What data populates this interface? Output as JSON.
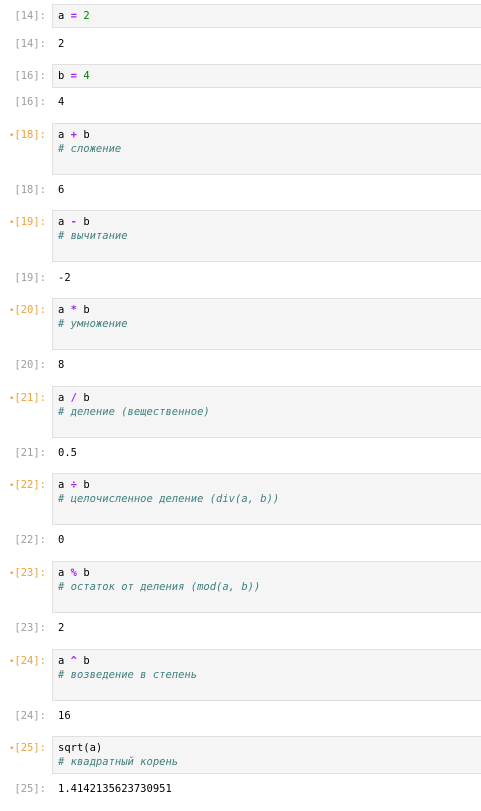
{
  "cells": [
    {
      "in": "[14]:",
      "out": "[14]:",
      "dirty": false,
      "code": {
        "a": "a",
        "op": "=",
        "b": "2"
      },
      "comment": "",
      "result": "2"
    },
    {
      "in": "[16]:",
      "out": "[16]:",
      "dirty": false,
      "code": {
        "a": "b",
        "op": "=",
        "b": "4"
      },
      "comment": "",
      "result": "4"
    },
    {
      "in": "[18]:",
      "out": "[18]:",
      "dirty": true,
      "code": {
        "a": "a",
        "op": "+",
        "b": "b"
      },
      "comment": "# сложение",
      "result": "6"
    },
    {
      "in": "[19]:",
      "out": "[19]:",
      "dirty": true,
      "code": {
        "a": "a",
        "op": "-",
        "b": "b"
      },
      "comment": "# вычитание",
      "result": "-2"
    },
    {
      "in": "[20]:",
      "out": "[20]:",
      "dirty": true,
      "code": {
        "a": "a",
        "op": "*",
        "b": "b"
      },
      "comment": "# умножение",
      "result": "8"
    },
    {
      "in": "[21]:",
      "out": "[21]:",
      "dirty": true,
      "code": {
        "a": "a",
        "op": "/",
        "b": "b"
      },
      "comment": "# деление (вещественное)",
      "result": "0.5"
    },
    {
      "in": "[22]:",
      "out": "[22]:",
      "dirty": true,
      "code": {
        "a": "a",
        "op": "÷",
        "b": "b"
      },
      "comment": "# целочисленное деление (div(a, b))",
      "result": "0"
    },
    {
      "in": "[23]:",
      "out": "[23]:",
      "dirty": true,
      "code": {
        "a": "a",
        "op": "%",
        "b": "b"
      },
      "comment": "# остаток от деления (mod(a, b))",
      "result": "2"
    },
    {
      "in": "[24]:",
      "out": "[24]:",
      "dirty": true,
      "code": {
        "a": "a",
        "op": "^",
        "b": "b"
      },
      "comment": "# возведение в степень",
      "result": "16"
    },
    {
      "in": "[25]:",
      "out": "[25]:",
      "dirty": true,
      "code": {
        "a": "sqrt(a)",
        "op": "",
        "b": ""
      },
      "comment": "# квадратный корень",
      "result": "1.4142135623730951"
    }
  ],
  "colors": {
    "dirty_prompt": "#e8a33b",
    "prompt": "#9e9e9e",
    "comment": "#408080",
    "operator": "#aa22ff",
    "number": "#008000"
  }
}
